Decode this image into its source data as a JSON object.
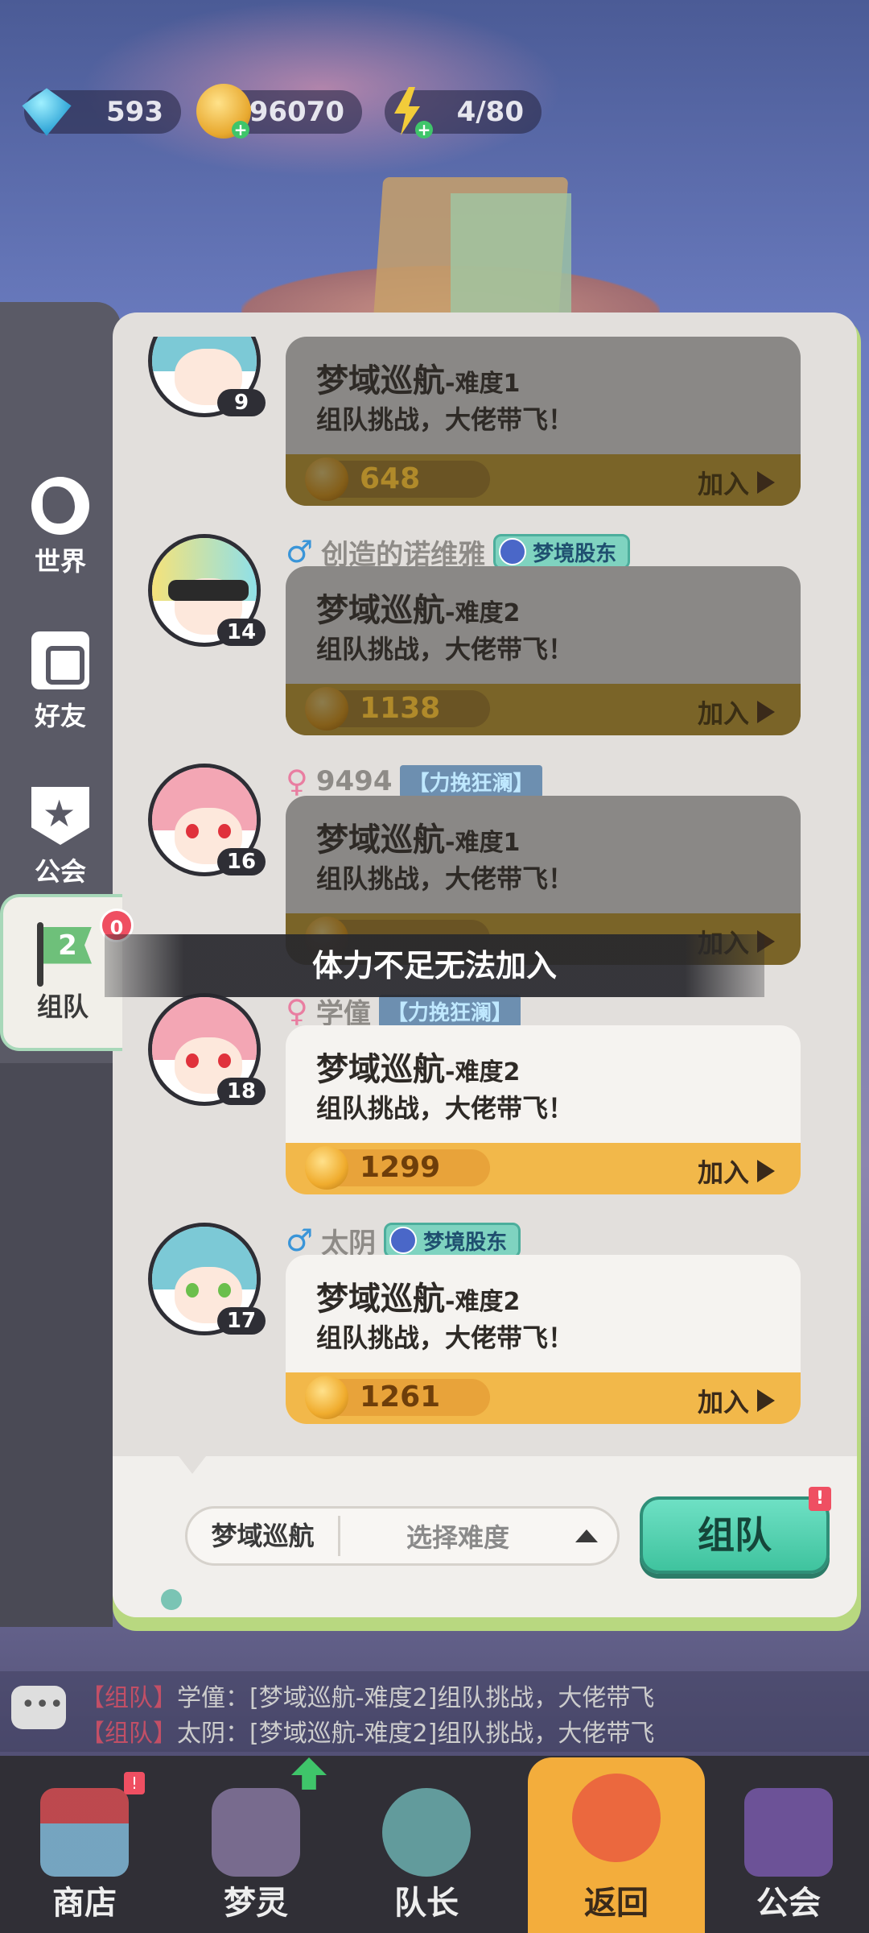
{
  "resources": {
    "diamonds": "593",
    "gold": "96070",
    "energy": "4/80"
  },
  "side_tabs": {
    "world": "世界",
    "friends": "好友",
    "guild": "公会",
    "team": "组队",
    "team_badge": "0"
  },
  "rows": [
    {
      "level": "9",
      "title": "梦域巡航",
      "difficulty": "-难度1",
      "subtitle": "组队挑战，大佬带飞！",
      "reward": "648",
      "join": "加入",
      "state": "disabled"
    },
    {
      "gender": "♂",
      "name": "创造的诺维雅",
      "tag": "梦境股东",
      "level": "14",
      "title": "梦域巡航",
      "difficulty": "-难度2",
      "subtitle": "组队挑战，大佬带飞！",
      "reward": "1138",
      "join": "加入",
      "state": "disabled"
    },
    {
      "gender": "♀",
      "name": "9494",
      "tag": "【力挽狂澜】",
      "level": "16",
      "title": "梦域巡航",
      "difficulty": "-难度1",
      "subtitle": "组队挑战，大佬带飞！",
      "reward": "",
      "join": "加入",
      "state": "disabled"
    },
    {
      "gender": "♀",
      "name": "学僮",
      "tag": "【力挽狂澜】",
      "level": "18",
      "title": "梦域巡航",
      "difficulty": "-难度2",
      "subtitle": "组队挑战，大佬带飞！",
      "reward": "1299",
      "join": "加入",
      "state": "enabled"
    },
    {
      "gender": "♂",
      "name": "太阴",
      "tag": "梦境股东",
      "level": "17",
      "title": "梦域巡航",
      "difficulty": "-难度2",
      "subtitle": "组队挑战，大佬带飞！",
      "reward": "1261",
      "join": "加入",
      "state": "enabled"
    }
  ],
  "toast": "体力不足无法加入",
  "team_form": {
    "category": "梦域巡航",
    "difficulty_placeholder": "选择难度",
    "create_button": "组队",
    "create_badge": "!"
  },
  "chat": [
    {
      "channel": "【组队】",
      "text": "学僮：[梦域巡航-难度2]组队挑战，大佬带飞"
    },
    {
      "channel": "【组队】",
      "text": "太阴：[梦域巡航-难度2]组队挑战，大佬带飞"
    }
  ],
  "bottom_nav": {
    "shop": "商店",
    "spirit": "梦灵",
    "captain": "队长",
    "back": "返回",
    "guild": "公会",
    "shop_badge": "!"
  },
  "colors": {
    "accent_green": "#3fc39e",
    "reward_gold": "#f2b84a",
    "badge_red": "#ef4f62"
  }
}
